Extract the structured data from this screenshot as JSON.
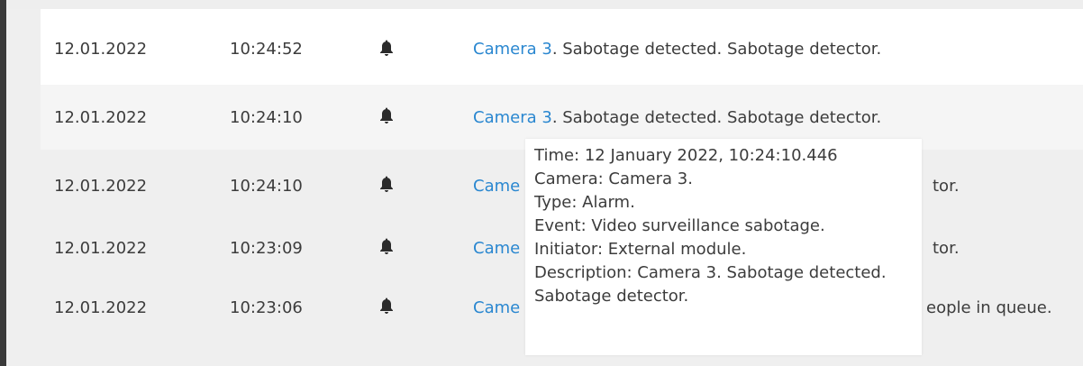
{
  "events": [
    {
      "date": "12.01.2022",
      "time": "10:24:52",
      "camera": "Camera 3",
      "text": ". Sabotage detected. Sabotage detector."
    },
    {
      "date": "12.01.2022",
      "time": "10:24:10",
      "camera": "Camera 3",
      "text": ". Sabotage detected. Sabotage detector."
    },
    {
      "date": "12.01.2022",
      "time": "10:24:10",
      "camera": "Came",
      "text": "tor."
    },
    {
      "date": "12.01.2022",
      "time": "10:23:09",
      "camera": "Came",
      "text": "tor."
    },
    {
      "date": "12.01.2022",
      "time": "10:23:06",
      "camera": "Came",
      "text": "eople in queue."
    }
  ],
  "tooltip": {
    "time": "Time: 12 January 2022, 10:24:10.446",
    "camera": "Camera: Camera 3.",
    "type": "Type: Alarm.",
    "event": "Event: Video surveillance sabotage.",
    "initiator": "Initiator: External module.",
    "description": "Description: Camera 3. Sabotage detected. Sabotage detector."
  },
  "icons": {
    "event_type": "bell-icon"
  },
  "colors": {
    "link": "#2a87d0",
    "text": "#3c3c3c",
    "selected_row_bg": "#ffffff",
    "row_bg": "#efefef"
  }
}
